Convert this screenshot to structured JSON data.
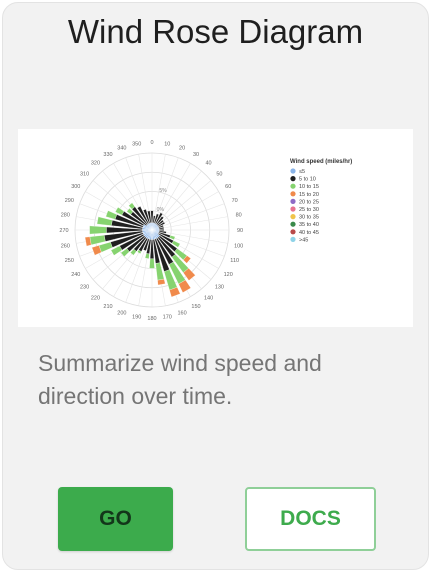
{
  "card": {
    "title": "Wind Rose Diagram",
    "description": "Summarize wind speed and direction over time.",
    "go_label": "GO",
    "docs_label": "DOCS"
  },
  "thumbnail": {
    "angle_labels": [
      "0",
      "10",
      "20",
      "30",
      "40",
      "50",
      "60",
      "70",
      "80",
      "90",
      "100",
      "110",
      "120",
      "130",
      "140",
      "150",
      "160",
      "170",
      "180",
      "190",
      "200",
      "210",
      "220",
      "230",
      "240",
      "250",
      "260",
      "270",
      "280",
      "290",
      "300",
      "310",
      "320",
      "330",
      "340",
      "350"
    ],
    "radial_labels": [
      "0%",
      "5%"
    ],
    "legend_title": "Wind speed (miles/hr)",
    "legend": [
      {
        "label": "≤5",
        "color": "#8ab4e8"
      },
      {
        "label": "5 to 10",
        "color": "#1f1f1f"
      },
      {
        "label": "10 to 15",
        "color": "#86d36f"
      },
      {
        "label": "15 to 20",
        "color": "#f08a4b"
      },
      {
        "label": "20 to 25",
        "color": "#8e6bc6"
      },
      {
        "label": "25 to 30",
        "color": "#e8738f"
      },
      {
        "label": "30 to 35",
        "color": "#f0c44a"
      },
      {
        "label": "35 to 40",
        "color": "#3a8a4a"
      },
      {
        "label": "40 to 45",
        "color": "#b84a4a"
      },
      {
        "label": ">45",
        "color": "#8fd3e8"
      }
    ],
    "directions": [
      {
        "deg": 0,
        "values": [
          3,
          5,
          0,
          0
        ]
      },
      {
        "deg": 10,
        "values": [
          3,
          3,
          0,
          0
        ]
      },
      {
        "deg": 20,
        "values": [
          3,
          4,
          0,
          0
        ]
      },
      {
        "deg": 30,
        "values": [
          3,
          5,
          0,
          0
        ]
      },
      {
        "deg": 40,
        "values": [
          3,
          4,
          0,
          0
        ]
      },
      {
        "deg": 50,
        "values": [
          3,
          3,
          0,
          0
        ]
      },
      {
        "deg": 60,
        "values": [
          3,
          3,
          0,
          0
        ]
      },
      {
        "deg": 70,
        "values": [
          3,
          2,
          0,
          0
        ]
      },
      {
        "deg": 80,
        "values": [
          3,
          2,
          0,
          0
        ]
      },
      {
        "deg": 90,
        "values": [
          3,
          2,
          0,
          0
        ]
      },
      {
        "deg": 100,
        "values": [
          3,
          3,
          0,
          0
        ]
      },
      {
        "deg": 110,
        "values": [
          3,
          5,
          2,
          0
        ]
      },
      {
        "deg": 120,
        "values": [
          3,
          7,
          3,
          0
        ]
      },
      {
        "deg": 130,
        "values": [
          4,
          9,
          5,
          2
        ]
      },
      {
        "deg": 140,
        "values": [
          4,
          10,
          8,
          4
        ]
      },
      {
        "deg": 150,
        "values": [
          4,
          12,
          9,
          4
        ]
      },
      {
        "deg": 160,
        "values": [
          4,
          14,
          8,
          3
        ]
      },
      {
        "deg": 170,
        "values": [
          4,
          10,
          7,
          2
        ]
      },
      {
        "deg": 180,
        "values": [
          4,
          8,
          4,
          0
        ]
      },
      {
        "deg": 190,
        "values": [
          4,
          6,
          2,
          0
        ]
      },
      {
        "deg": 200,
        "values": [
          4,
          5,
          0,
          0
        ]
      },
      {
        "deg": 210,
        "values": [
          4,
          6,
          1,
          0
        ]
      },
      {
        "deg": 220,
        "values": [
          4,
          7,
          2,
          0
        ]
      },
      {
        "deg": 230,
        "values": [
          4,
          9,
          3,
          0
        ]
      },
      {
        "deg": 240,
        "values": [
          4,
          11,
          4,
          0
        ]
      },
      {
        "deg": 250,
        "values": [
          4,
          14,
          5,
          3
        ]
      },
      {
        "deg": 260,
        "values": [
          4,
          16,
          6,
          2
        ]
      },
      {
        "deg": 270,
        "values": [
          4,
          15,
          7,
          0
        ]
      },
      {
        "deg": 280,
        "values": [
          4,
          13,
          6,
          0
        ]
      },
      {
        "deg": 290,
        "values": [
          4,
          12,
          4,
          0
        ]
      },
      {
        "deg": 300,
        "values": [
          4,
          10,
          3,
          0
        ]
      },
      {
        "deg": 310,
        "values": [
          3,
          8,
          2,
          0
        ]
      },
      {
        "deg": 320,
        "values": [
          3,
          9,
          2,
          0
        ]
      },
      {
        "deg": 330,
        "values": [
          3,
          8,
          0,
          0
        ]
      },
      {
        "deg": 340,
        "values": [
          3,
          6,
          0,
          0
        ]
      },
      {
        "deg": 350,
        "values": [
          3,
          5,
          0,
          0
        ]
      }
    ],
    "max_value": 32
  }
}
